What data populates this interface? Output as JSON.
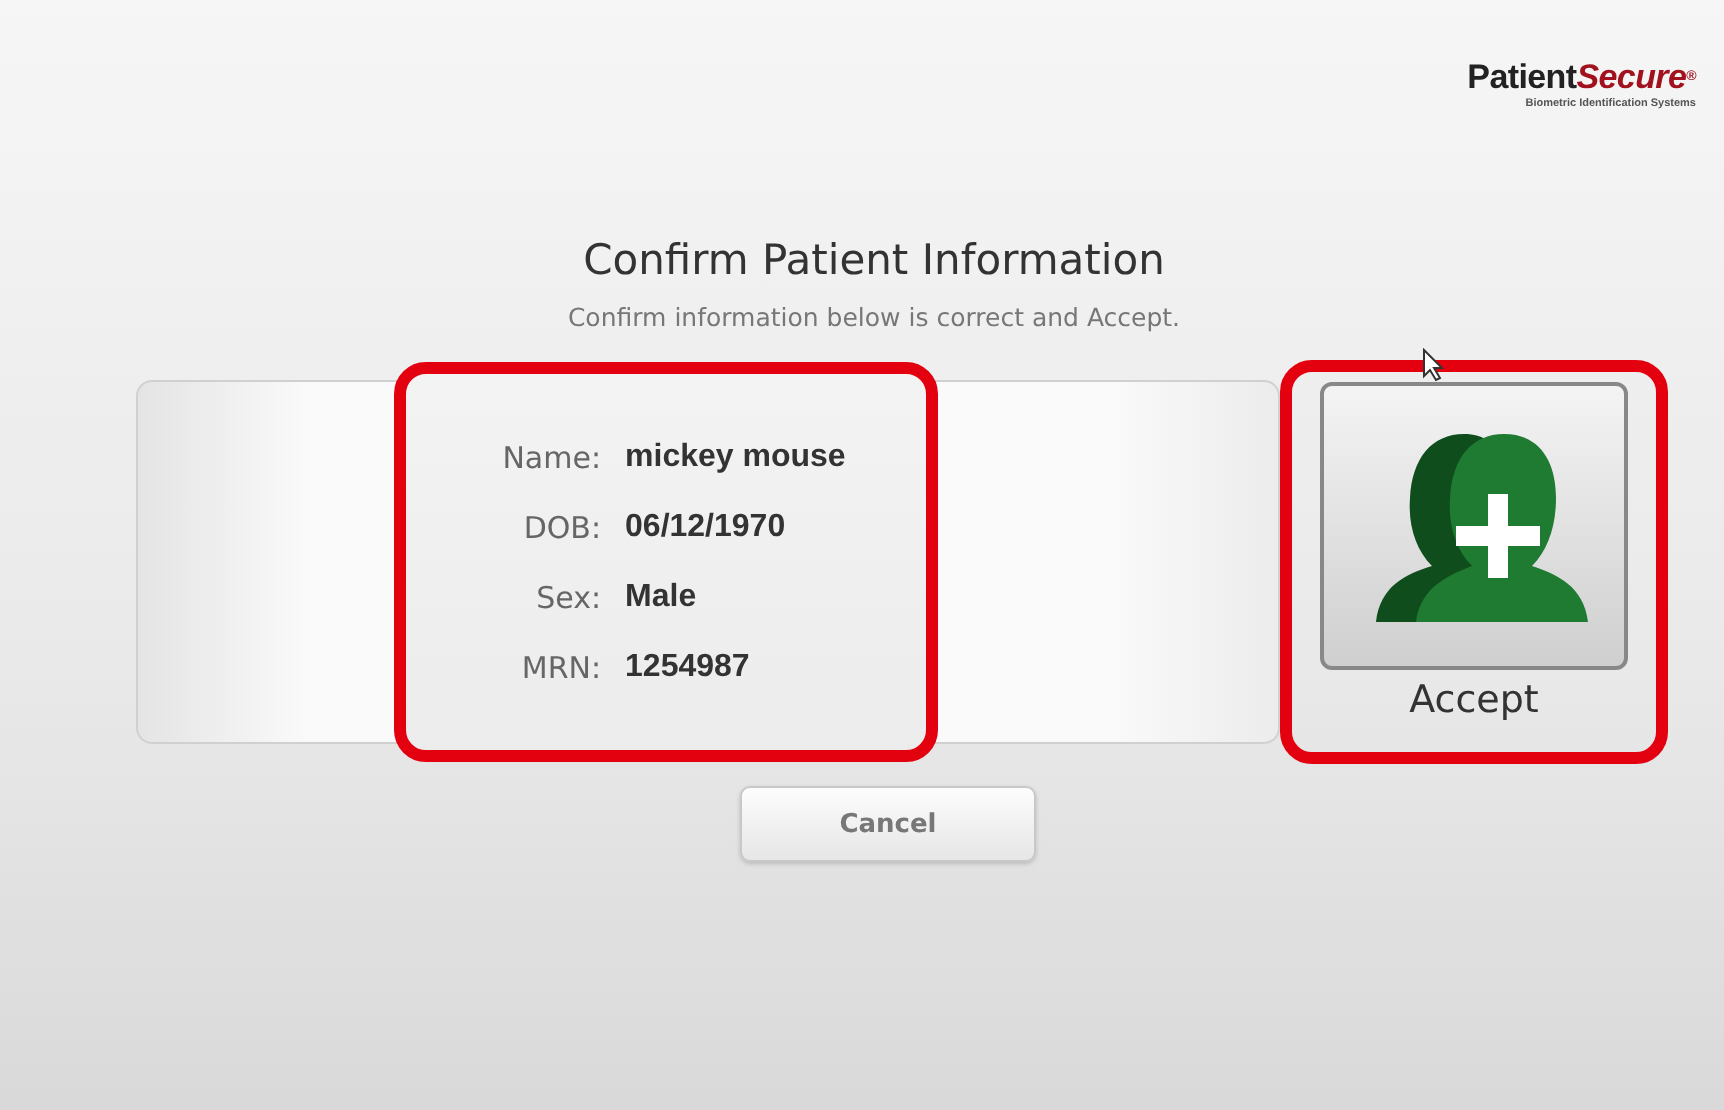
{
  "logo": {
    "wordmark": [
      {
        "text": "Patient",
        "kind": "plain"
      },
      {
        "text": "Secure",
        "kind": "accent"
      },
      {
        "text": "®",
        "kind": "mark"
      }
    ],
    "tagline": "Biometric Identification Systems"
  },
  "title": "Confirm Patient Information",
  "subtitle": "Confirm information below is correct and Accept.",
  "patient_fields": [
    {
      "label": "Name:",
      "value": "mickey mouse"
    },
    {
      "label": "DOB:",
      "value": "06/12/1970"
    },
    {
      "label": "Sex:",
      "value": "Male"
    },
    {
      "label": "MRN:",
      "value": "1254987"
    }
  ],
  "accept_button": {
    "label": "Accept"
  },
  "cancel_button": {
    "label": "Cancel"
  }
}
